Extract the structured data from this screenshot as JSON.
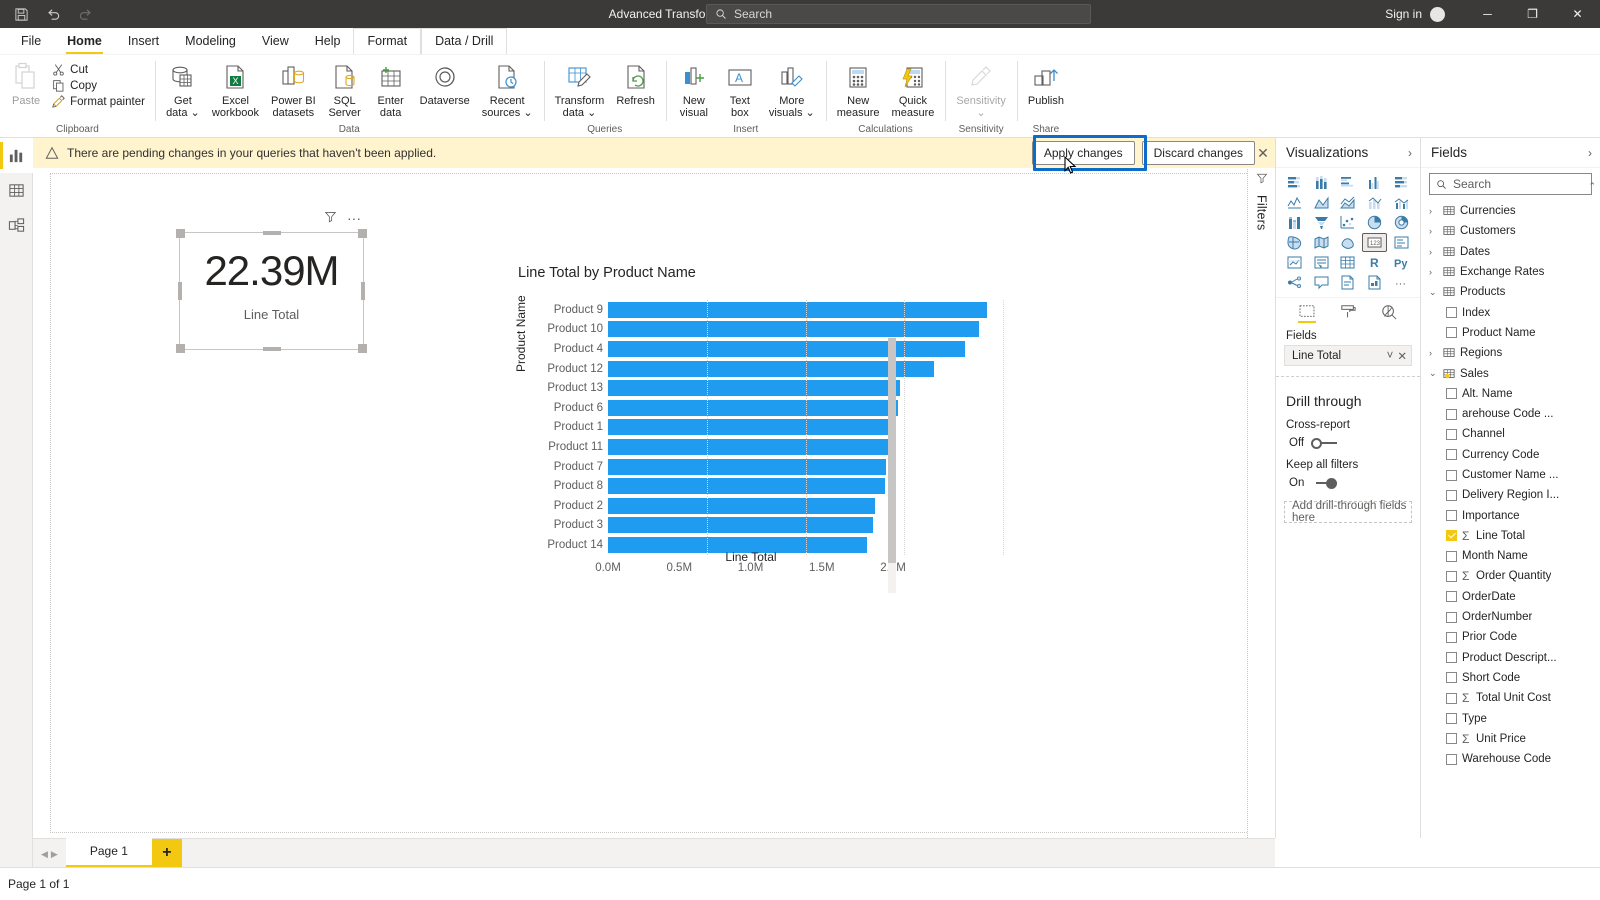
{
  "titlebar": {
    "document_title": "Advanced Transformation and Querying Techniques - Power BI Desktop",
    "save_icon": "save-icon",
    "undo_icon": "undo-icon",
    "redo_icon": "redo-icon",
    "search_placeholder": "Search",
    "search_icon": "search-icon",
    "signin_label": "Sign in",
    "minimize_label": "─",
    "maximize_label": "❐",
    "close_label": "✕"
  },
  "ribbon": {
    "tabs": [
      {
        "label": "File",
        "active": false,
        "context": false
      },
      {
        "label": "Home",
        "active": true,
        "context": false
      },
      {
        "label": "Insert",
        "active": false,
        "context": false
      },
      {
        "label": "Modeling",
        "active": false,
        "context": false
      },
      {
        "label": "View",
        "active": false,
        "context": false
      },
      {
        "label": "Help",
        "active": false,
        "context": false
      },
      {
        "label": "Format",
        "active": false,
        "context": true
      },
      {
        "label": "Data / Drill",
        "active": false,
        "context": true
      }
    ],
    "groups": [
      {
        "label": "Clipboard",
        "paste": "Paste",
        "items": [
          {
            "label": "Cut",
            "icon": "scissors-icon"
          },
          {
            "label": "Copy",
            "icon": "copy-icon"
          },
          {
            "label": "Format painter",
            "icon": "format-painter-icon"
          }
        ]
      },
      {
        "label": "Data",
        "items": [
          {
            "label": "Get\ndata",
            "l1": "Get",
            "l2": "data",
            "caret": true,
            "icon": "get-data-icon"
          },
          {
            "label": "Excel workbook",
            "l1": "Excel",
            "l2": "workbook",
            "caret": false,
            "icon": "excel-icon"
          },
          {
            "label": "Power BI datasets",
            "l1": "Power BI",
            "l2": "datasets",
            "caret": false,
            "icon": "powerbi-datasets-icon"
          },
          {
            "label": "SQL Server",
            "l1": "SQL",
            "l2": "Server",
            "caret": false,
            "icon": "sql-server-icon"
          },
          {
            "label": "Enter data",
            "l1": "Enter",
            "l2": "data",
            "caret": false,
            "icon": "enter-data-icon"
          },
          {
            "label": "Dataverse",
            "l1": "Dataverse",
            "l2": "",
            "caret": false,
            "icon": "dataverse-icon"
          },
          {
            "label": "Recent sources",
            "l1": "Recent",
            "l2": "sources",
            "caret": true,
            "icon": "recent-sources-icon"
          }
        ]
      },
      {
        "label": "Queries",
        "items": [
          {
            "label": "Transform data",
            "l1": "Transform",
            "l2": "data",
            "caret": true,
            "icon": "transform-data-icon"
          },
          {
            "label": "Refresh",
            "l1": "Refresh",
            "l2": "",
            "caret": false,
            "icon": "refresh-icon"
          }
        ]
      },
      {
        "label": "Insert",
        "items": [
          {
            "label": "New visual",
            "l1": "New",
            "l2": "visual",
            "caret": false,
            "icon": "new-visual-icon"
          },
          {
            "label": "Text box",
            "l1": "Text",
            "l2": "box",
            "caret": false,
            "icon": "text-box-icon"
          },
          {
            "label": "More visuals",
            "l1": "More",
            "l2": "visuals",
            "caret": true,
            "icon": "more-visuals-icon"
          }
        ]
      },
      {
        "label": "Calculations",
        "items": [
          {
            "label": "New measure",
            "l1": "New",
            "l2": "measure",
            "caret": false,
            "icon": "new-measure-icon"
          },
          {
            "label": "Quick measure",
            "l1": "Quick",
            "l2": "measure",
            "caret": false,
            "icon": "quick-measure-icon"
          }
        ]
      },
      {
        "label": "Sensitivity",
        "items": [
          {
            "label": "Sensitivity",
            "l1": "Sensitivity",
            "l2": "",
            "caret": true,
            "icon": "sensitivity-icon",
            "disabled": true
          }
        ]
      },
      {
        "label": "Share",
        "items": [
          {
            "label": "Publish",
            "l1": "Publish",
            "l2": "",
            "caret": false,
            "icon": "publish-icon"
          }
        ]
      }
    ]
  },
  "banner": {
    "message": "There are pending changes in your queries that haven't been applied.",
    "warning_icon": "warning-triangle-icon",
    "apply_label": "Apply changes",
    "discard_label": "Discard changes",
    "close_label": "✕",
    "highlight_color": "#0b6ccb",
    "background_color": "#fff4ce"
  },
  "leftrail": {
    "items": [
      {
        "icon": "report-view-icon",
        "name": "report-view",
        "active": true
      },
      {
        "icon": "data-view-icon",
        "name": "data-view",
        "active": false
      },
      {
        "icon": "model-view-icon",
        "name": "model-view",
        "active": false
      }
    ]
  },
  "card_visual": {
    "value": "22.39M",
    "label": "Line Total",
    "filter_icon": "filter-funnel-icon",
    "more_icon": "more-options-icon"
  },
  "chart_data": {
    "type": "bar",
    "orientation": "horizontal",
    "title": "Line Total by Product Name",
    "xlabel": "Line Total",
    "ylabel": "Product Name",
    "categories": [
      "Product 9",
      "Product 10",
      "Product 4",
      "Product 12",
      "Product 13",
      "Product 6",
      "Product 1",
      "Product 11",
      "Product 7",
      "Product 8",
      "Product 2",
      "Product 3",
      "Product 14"
    ],
    "values": [
      1.92,
      1.88,
      1.81,
      1.65,
      1.48,
      1.47,
      1.44,
      1.43,
      1.41,
      1.4,
      1.35,
      1.34,
      1.31
    ],
    "value_unit": "M",
    "xlim": [
      0,
      2.0
    ],
    "xticks": [
      "0.0M",
      "0.5M",
      "1.0M",
      "1.5M",
      "2.0M"
    ],
    "xtick_values": [
      0,
      0.5,
      1.0,
      1.5,
      2.0
    ],
    "bar_color": "#1f9bf0",
    "grid": true,
    "legend": "none"
  },
  "filters_rail": {
    "label": "Filters",
    "icon": "filter-funnel-icon",
    "expand_icon": "chevron-left-icon"
  },
  "visualizations": {
    "title": "Visualizations",
    "collapse_icon": "chevron-right-icon",
    "gallery": [
      {
        "name": "stacked-bar-chart-icon"
      },
      {
        "name": "stacked-column-chart-icon"
      },
      {
        "name": "clustered-bar-chart-icon"
      },
      {
        "name": "clustered-column-chart-icon"
      },
      {
        "name": "100-stacked-bar-chart-icon"
      },
      {
        "name": "line-chart-icon"
      },
      {
        "name": "area-chart-icon"
      },
      {
        "name": "stacked-area-chart-icon"
      },
      {
        "name": "line-stacked-column-icon"
      },
      {
        "name": "line-clustered-column-icon"
      },
      {
        "name": "ribbon-chart-icon"
      },
      {
        "name": "funnel-chart-icon"
      },
      {
        "name": "scatter-chart-icon"
      },
      {
        "name": "pie-chart-icon"
      },
      {
        "name": "donut-chart-icon"
      },
      {
        "name": "treemap-icon"
      },
      {
        "name": "map-icon"
      },
      {
        "name": "filled-map-icon"
      },
      {
        "name": "card-icon"
      },
      {
        "name": "multi-row-card-icon"
      },
      {
        "name": "kpi-icon"
      },
      {
        "name": "slicer-icon"
      },
      {
        "name": "table-icon"
      },
      {
        "name": "r-script-visual-icon"
      },
      {
        "name": "python-visual-icon"
      },
      {
        "name": "key-influencers-icon"
      },
      {
        "name": "qna-icon"
      },
      {
        "name": "paginated-report-icon"
      },
      {
        "name": "decomposition-tree-icon"
      },
      {
        "name": "more-visuals-icon"
      }
    ],
    "selected_index": 18,
    "tabs": [
      {
        "name": "fields-tab",
        "icon": "fields-build-icon",
        "active": true
      },
      {
        "name": "format-tab",
        "icon": "paint-roller-icon",
        "active": false
      },
      {
        "name": "analytics-tab",
        "icon": "analytics-magnifier-icon",
        "active": false
      }
    ],
    "fields_label": "Fields",
    "field_well": {
      "value": "Line Total",
      "chevron": "˅",
      "remove": "✕"
    },
    "drill_through": {
      "heading": "Drill through",
      "cross_report_label": "Cross-report",
      "cross_report_state": "Off",
      "keep_filters_label": "Keep all filters",
      "keep_filters_state": "On",
      "drop_placeholder": "Add drill-through fields here"
    }
  },
  "fields": {
    "title": "Fields",
    "collapse_icon": "chevron-right-icon",
    "search_placeholder": "Search",
    "search_icon": "search-icon",
    "tables": [
      {
        "name": "Currencies",
        "expanded": false,
        "icon": "table-icon",
        "fields": []
      },
      {
        "name": "Customers",
        "expanded": false,
        "icon": "table-icon",
        "fields": []
      },
      {
        "name": "Dates",
        "expanded": false,
        "icon": "table-icon",
        "fields": []
      },
      {
        "name": "Exchange Rates",
        "expanded": false,
        "icon": "table-icon",
        "fields": []
      },
      {
        "name": "Products",
        "expanded": true,
        "icon": "table-icon",
        "fields": [
          {
            "name": "Index",
            "checked": false,
            "measure": false
          },
          {
            "name": "Product Name",
            "checked": false,
            "measure": false
          }
        ]
      },
      {
        "name": "Regions",
        "expanded": false,
        "icon": "table-icon",
        "fields": []
      },
      {
        "name": "Sales",
        "expanded": true,
        "icon": "table-key-icon",
        "fields": [
          {
            "name": "Alt. Name",
            "checked": false,
            "measure": false
          },
          {
            "name": "arehouse Code ...",
            "checked": false,
            "measure": false
          },
          {
            "name": "Channel",
            "checked": false,
            "measure": false
          },
          {
            "name": "Currency Code",
            "checked": false,
            "measure": false
          },
          {
            "name": "Customer Name ...",
            "checked": false,
            "measure": false
          },
          {
            "name": "Delivery Region I...",
            "checked": false,
            "measure": false
          },
          {
            "name": "Importance",
            "checked": false,
            "measure": false
          },
          {
            "name": "Line Total",
            "checked": true,
            "measure": true
          },
          {
            "name": "Month Name",
            "checked": false,
            "measure": false
          },
          {
            "name": "Order Quantity",
            "checked": false,
            "measure": true
          },
          {
            "name": "OrderDate",
            "checked": false,
            "measure": false
          },
          {
            "name": "OrderNumber",
            "checked": false,
            "measure": false
          },
          {
            "name": "Prior Code",
            "checked": false,
            "measure": false
          },
          {
            "name": "Product Descript...",
            "checked": false,
            "measure": false
          },
          {
            "name": "Short Code",
            "checked": false,
            "measure": false
          },
          {
            "name": "Total Unit Cost",
            "checked": false,
            "measure": true
          },
          {
            "name": "Type",
            "checked": false,
            "measure": false
          },
          {
            "name": "Unit Price",
            "checked": false,
            "measure": true
          },
          {
            "name": "Warehouse Code",
            "checked": false,
            "measure": false
          }
        ]
      }
    ]
  },
  "pagebar": {
    "prev_icon": "◀",
    "next_icon": "▶",
    "pages": [
      {
        "label": "Page 1",
        "active": true
      }
    ],
    "add_label": "+"
  },
  "statusbar": {
    "text": "Page 1 of 1"
  }
}
